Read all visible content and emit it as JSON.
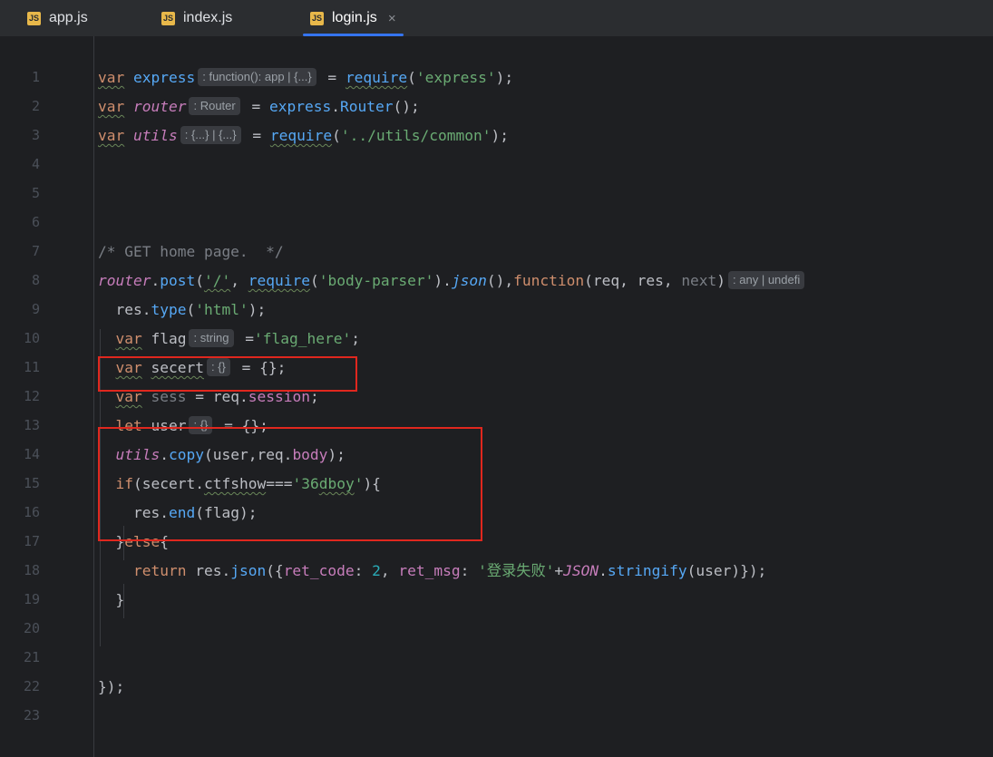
{
  "tabs": [
    {
      "label": "app.js",
      "icon": "JS",
      "active": false
    },
    {
      "label": "index.js",
      "icon": "JS",
      "active": false
    },
    {
      "label": "login.js",
      "icon": "JS",
      "active": true,
      "close": "×"
    }
  ],
  "line_numbers": [
    "1",
    "2",
    "3",
    "4",
    "5",
    "6",
    "7",
    "8",
    "9",
    "10",
    "11",
    "12",
    "13",
    "14",
    "15",
    "16",
    "17",
    "18",
    "19",
    "20",
    "21",
    "22",
    "23"
  ],
  "code": {
    "l1": {
      "kw": "var",
      "name": "express",
      "hint": ": function(): app | {...}",
      "eq": " = ",
      "req": "require",
      "p1": "(",
      "str": "'express'",
      "p2": ");"
    },
    "l2": {
      "kw": "var",
      "name": "router",
      "hint": ": Router",
      "eq": " = ",
      "obj": "express",
      "dot": ".",
      "fn": "Router",
      "rest": "();"
    },
    "l3": {
      "kw": "var",
      "name": "utils",
      "hint": ": {...} | {...}",
      "eq": " = ",
      "req": "require",
      "p1": "(",
      "str": "'../utils/common'",
      "p2": ");"
    },
    "l7": {
      "comment": "/* GET home page.  */"
    },
    "l8": {
      "obj": "router",
      "dot": ".",
      "fn": "post",
      "p1": "(",
      "str1": "'/'",
      "c1": ", ",
      "req": "require",
      "p2": "(",
      "str2": "'body-parser'",
      "p3": ").",
      "fn2": "json",
      "p4": "(),",
      "kw": "function",
      "params": "(req, res, ",
      "next": "next",
      "p5": ")",
      "hint": ": any | undefi"
    },
    "l9": {
      "obj": "res",
      "dot": ".",
      "fn": "type",
      "p1": "(",
      "str": "'html'",
      "p2": ");"
    },
    "l10": {
      "kw": "var",
      "name": "flag",
      "hint": ": string",
      "eq": " =",
      "str": "'flag_here'",
      "semi": ";"
    },
    "l11": {
      "kw": "var",
      "name": "secert",
      "hint": ": {}",
      "rest": " = {};"
    },
    "l12": {
      "kw": "var",
      "name": "sess",
      "eq": " = req.",
      "prop": "session",
      "semi": ";"
    },
    "l13": {
      "kw": "let",
      "name": "user",
      "hint": ": {}",
      "rest": " = {};"
    },
    "l14": {
      "obj": "utils",
      "dot": ".",
      "fn": "copy",
      "p1": "(user,req.",
      "prop": "body",
      "p2": ");"
    },
    "l15": {
      "kw": "if",
      "p1": "(secert.",
      "prop": "ctfshow",
      "eq": "===",
      "str1": "'36",
      "strund": "dboy",
      "str2": "'",
      "p2": "){"
    },
    "l16": {
      "obj": "res",
      "dot": ".",
      "fn": "end",
      "rest": "(flag);"
    },
    "l17": {
      "p1": "}",
      "kw": "else",
      "p2": "{"
    },
    "l18": {
      "kw": "return",
      "p1": " res.",
      "fn": "json",
      "p2": "({",
      "prop1": "ret_code",
      "c1": ": ",
      "num": "2",
      "c2": ", ",
      "prop2": "ret_msg",
      "c3": ": ",
      "str": "'登录失败'",
      "plus": "+",
      "obj": "JSON",
      "dot": ".",
      "fn2": "stringify",
      "rest": "(user)});"
    },
    "l19": {
      "p1": "}"
    },
    "l22": {
      "p1": "});"
    }
  },
  "colors": {
    "background": "#1e1f22",
    "keyword": "#cf8e6d",
    "function": "#56a8f5",
    "string": "#6aab73",
    "property": "#c77dbb",
    "highlight_box": "#e0271e"
  }
}
